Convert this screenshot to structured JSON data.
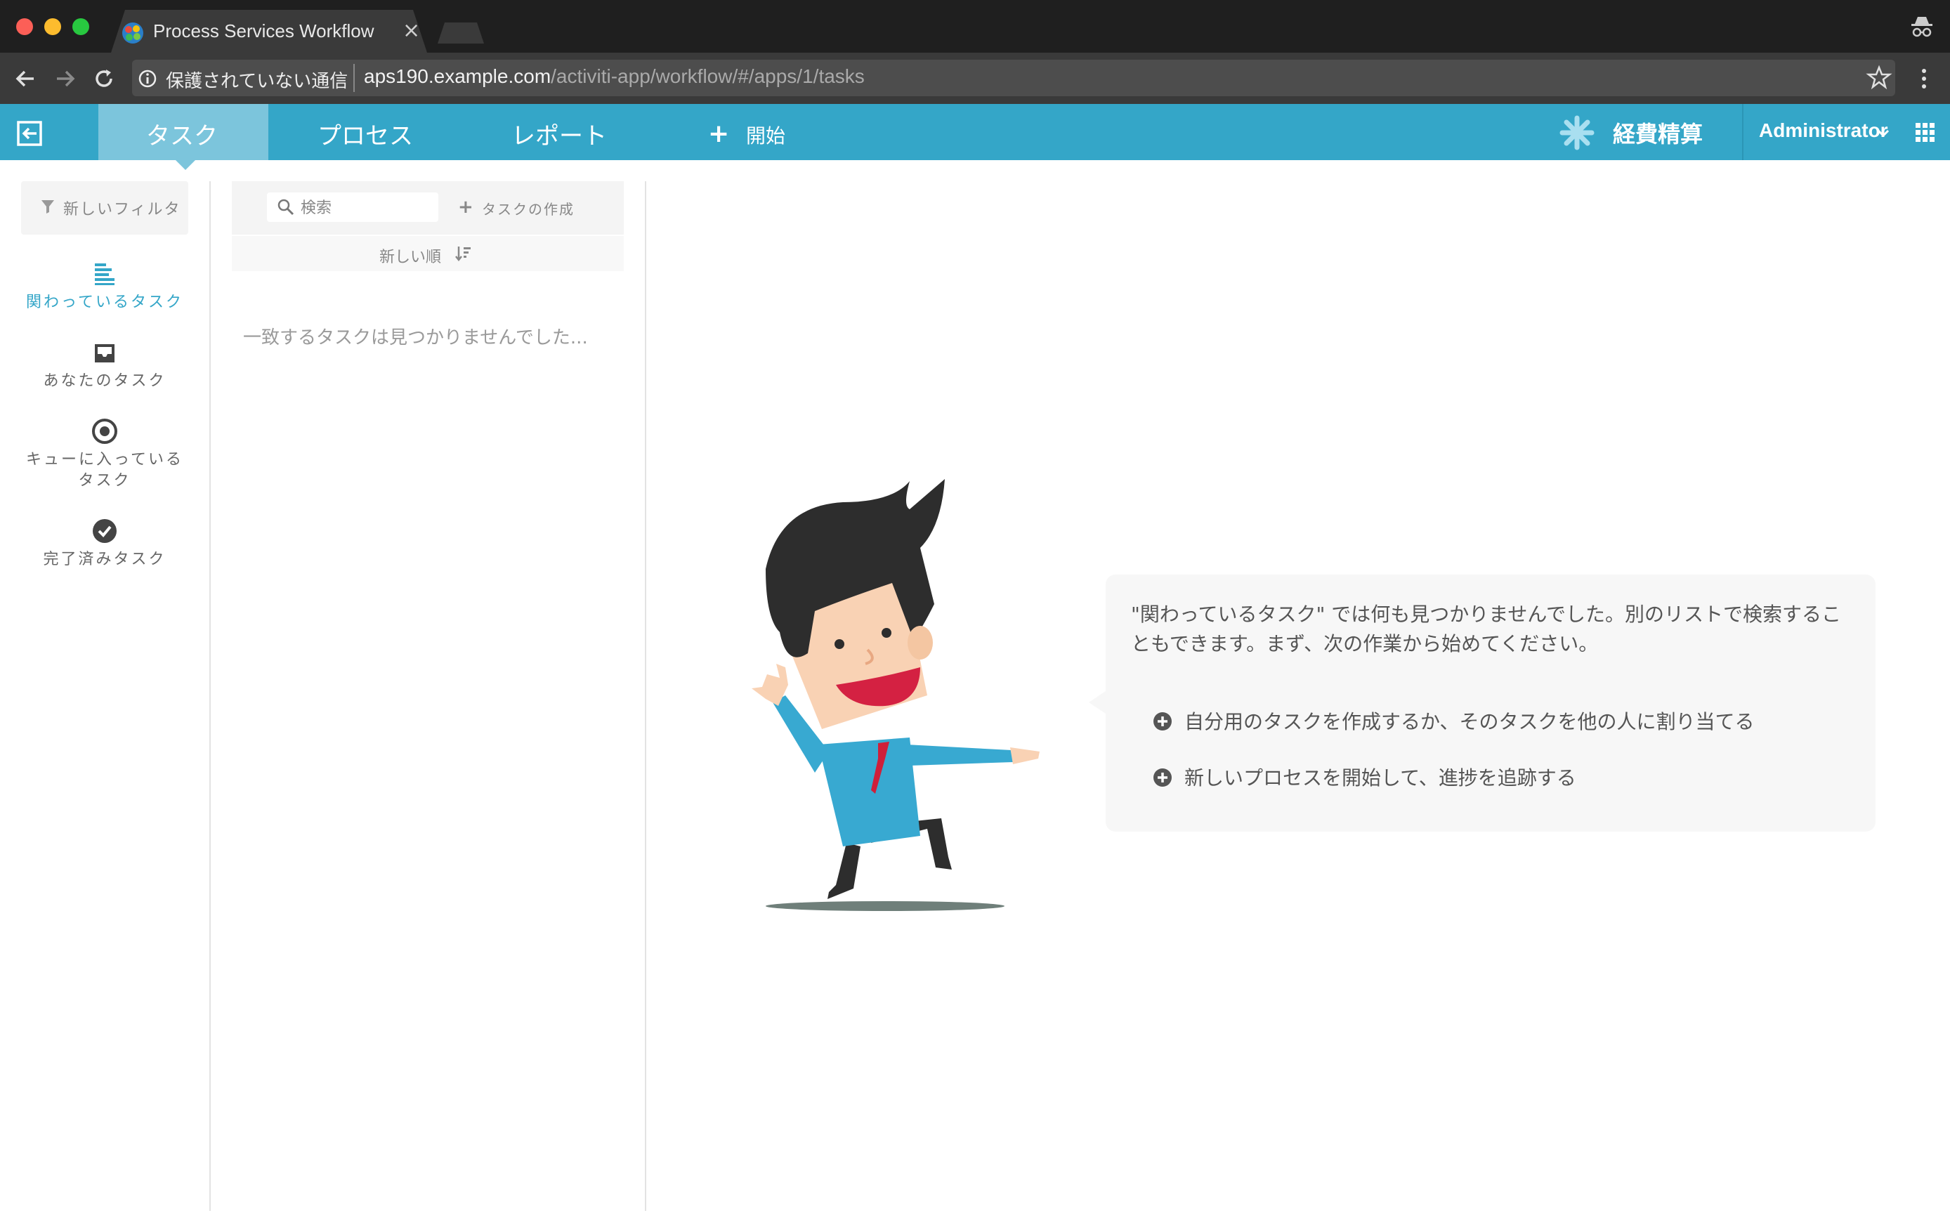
{
  "browser": {
    "tab_title": "Process Services Workflow",
    "tab_close": "×",
    "url_warning": "保護されていない通信",
    "url_host": "aps190.example.com",
    "url_path": "/activiti-app/workflow/#/apps/1/tasks"
  },
  "header": {
    "tabs": [
      {
        "label": "タスク",
        "active": true
      },
      {
        "label": "プロセス"
      },
      {
        "label": "レポート"
      }
    ],
    "start_plus": "+",
    "start_label": "開始",
    "app_name": "経費精算",
    "user_name": "Administrator",
    "accent_color": "#34a6c8",
    "active_tab_color": "#7cc5dc"
  },
  "filters": {
    "new_filter_label": "新しいフィルタ",
    "items": [
      {
        "label": "関わっているタスク",
        "icon": "involved-tasks-icon",
        "active": true
      },
      {
        "label": "あなたのタスク",
        "icon": "inbox-icon"
      },
      {
        "label": "キューに入っている\nタスク",
        "icon": "target-icon"
      },
      {
        "label": "完了済みタスク",
        "icon": "check-circle-icon"
      }
    ]
  },
  "task_list": {
    "search_placeholder": "検索",
    "create_task_plus": "+",
    "create_task_label": "タスクの作成",
    "sort_label": "新しい順",
    "empty_message": "一致するタスクは見つかりませんでした..."
  },
  "help": {
    "message": "\"関わっているタスク\" では何も見つかりませんでした。別のリストで検索することもできます。まず、次の作業から始めてください。",
    "actions": [
      {
        "label": "自分用のタスクを作成するか、そのタスクを他の人に割り当てる"
      },
      {
        "label": "新しいプロセスを開始して、進捗を追跡する"
      }
    ]
  }
}
